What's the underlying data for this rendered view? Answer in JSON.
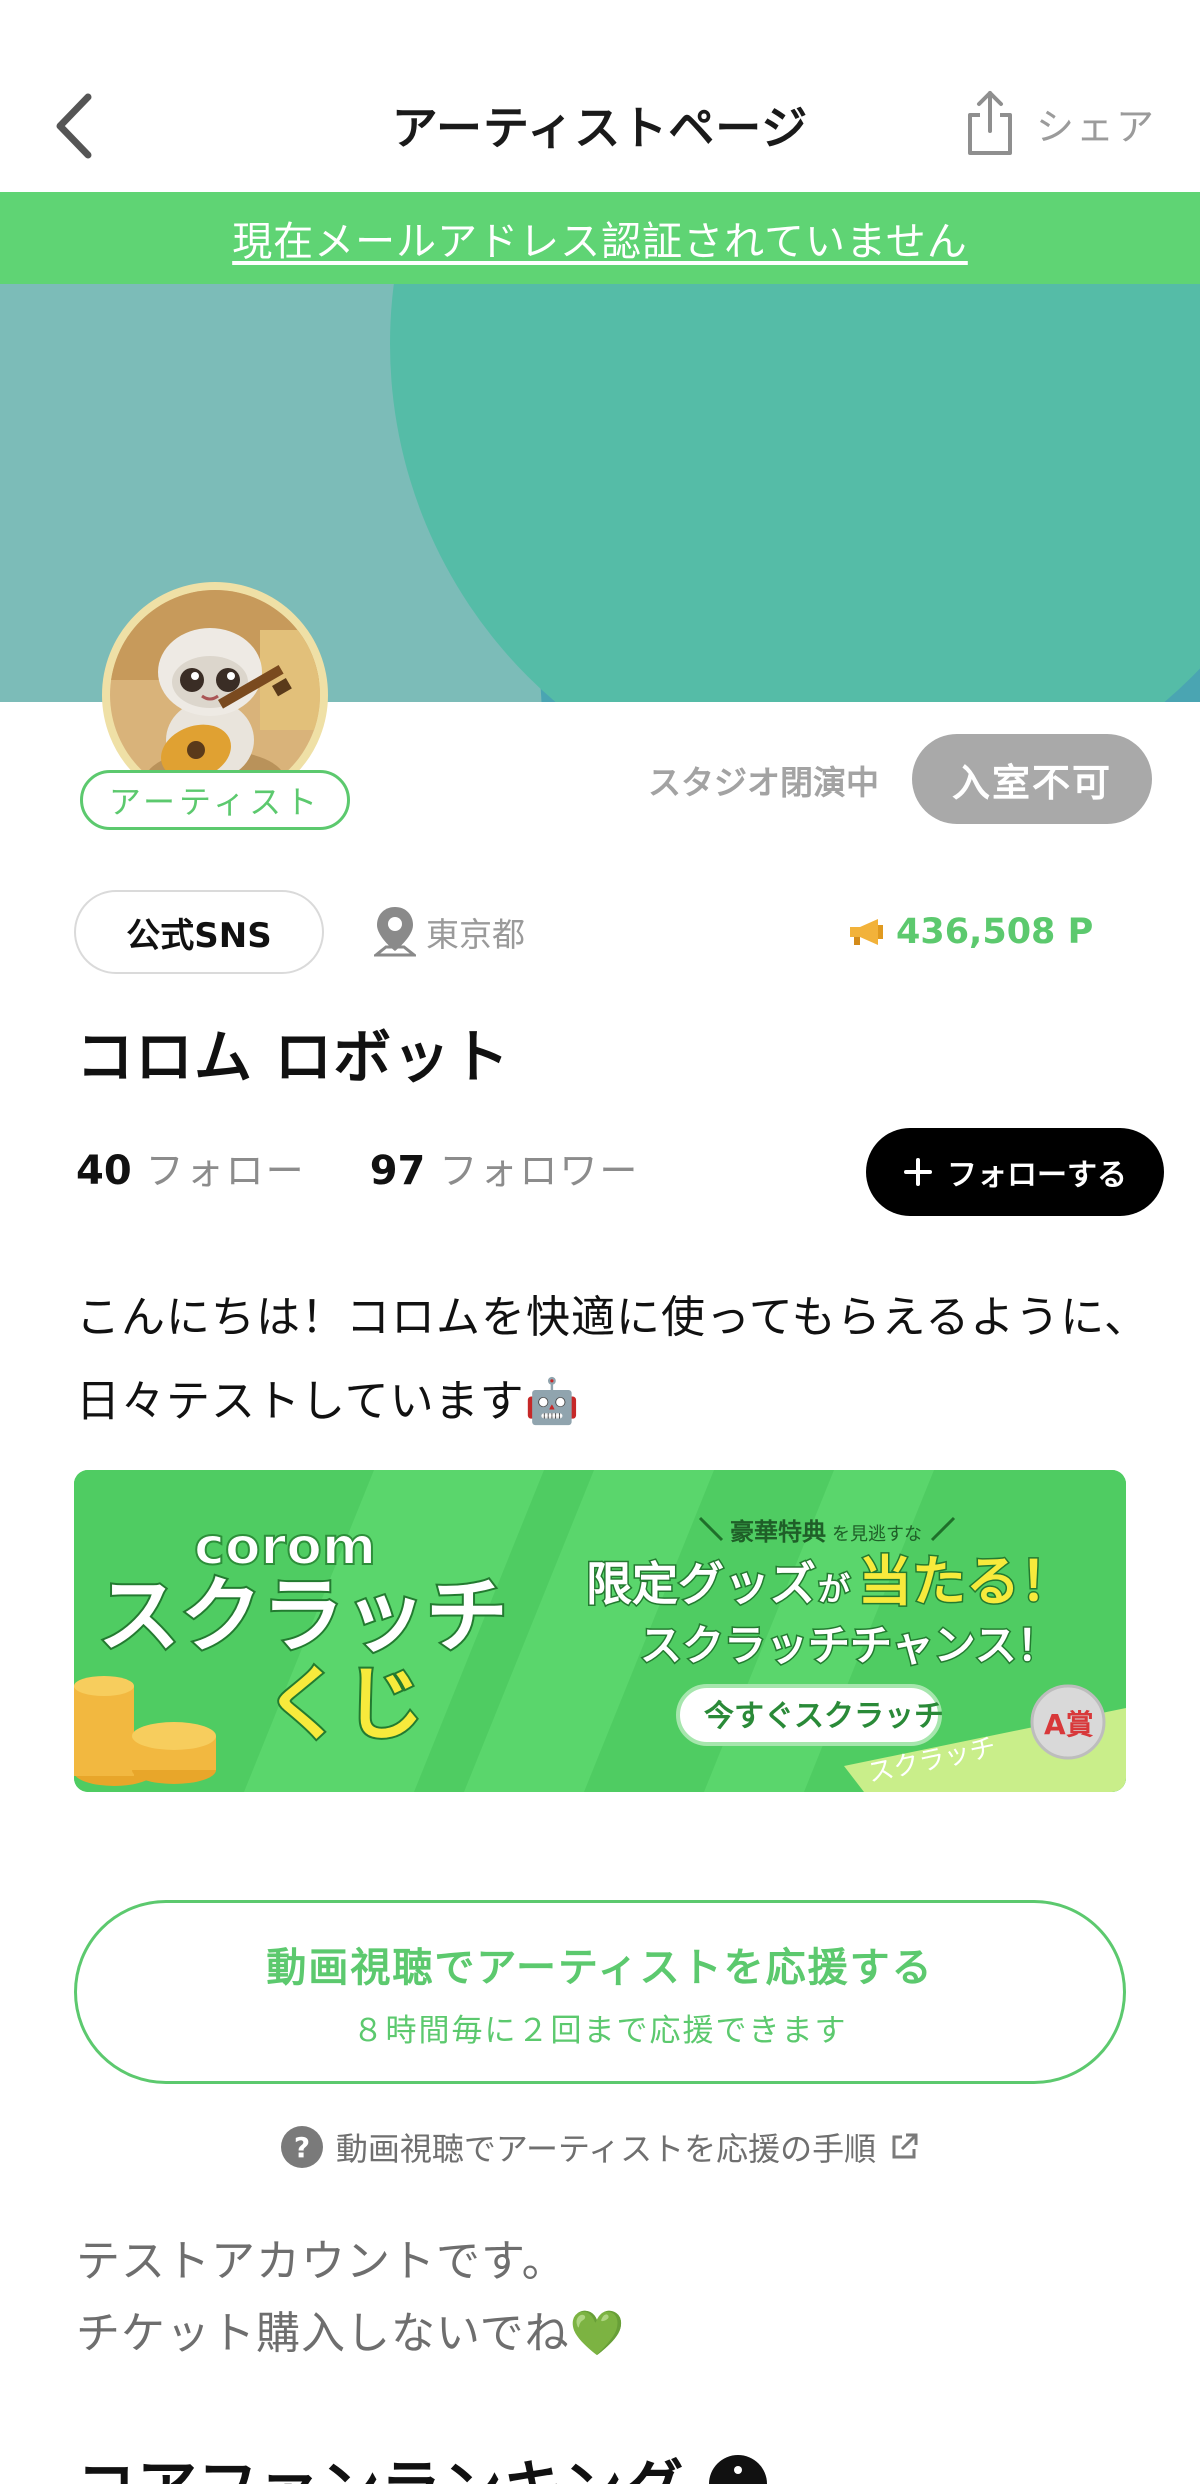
{
  "header": {
    "title": "アーティストページ",
    "share_label": "シェア"
  },
  "email_banner": {
    "text": "現在メールアドレス認証されていません"
  },
  "colors": {
    "accent_green": "#5cc96e",
    "banner_green": "#5fd474",
    "button_gray": "#a9a9a9",
    "black": "#000000"
  },
  "profile": {
    "badge": "アーティスト",
    "studio_status": "スタジオ閉演中",
    "enter_button": "入室不可",
    "sns_button": "公式SNS",
    "location": "東京都",
    "points": "436,508 P",
    "name": "コロム ロボット",
    "follow_count": "40",
    "follow_label": "フォロー",
    "follower_count": "97",
    "follower_label": "フォロワー",
    "follow_button": "フォローする",
    "bio_line1": "こんにちは！コロムを快適に使ってもらえるように、",
    "bio_line2": "日々テストしています",
    "bio_emoji": "🤖"
  },
  "scratch_banner": {
    "brand": "corom",
    "title_line1": "スクラッチ",
    "title_line2": "くじ",
    "tagline_strong": "豪華特典",
    "tagline_rest": "を見逃すな",
    "headline_1a": "限定グッズ",
    "headline_1b": "が",
    "headline_1c": "当たる！",
    "headline_2": "スクラッチチャンス！",
    "cta": "今すぐスクラッチ",
    "ticket_label": "スクラッチ",
    "prize_label": "A賞"
  },
  "support": {
    "title": "動画視聴でアーティストを応援する",
    "subtitle": "８時間毎に２回まで応援できます",
    "help_link": "動画視聴でアーティストを応援の手順"
  },
  "notes": {
    "line1": "テストアカウントです。",
    "line2": "チケット購入しないでね",
    "line2_emoji": "💚"
  },
  "ranking": {
    "title": "コアファンランキング"
  }
}
